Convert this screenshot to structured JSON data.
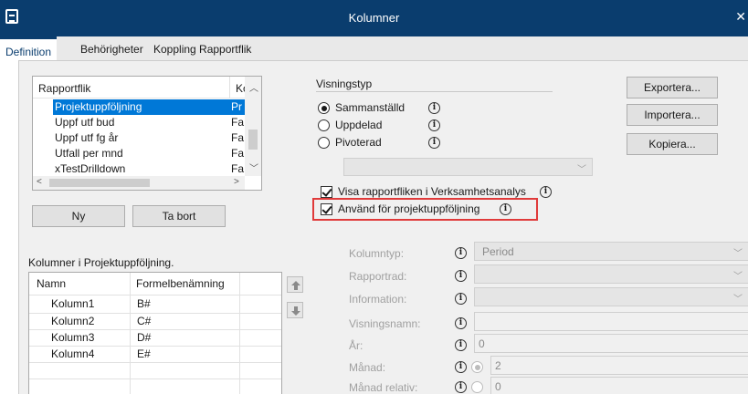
{
  "window": {
    "title": "Kolumner"
  },
  "tabs": [
    "Definition",
    "Behörigheter",
    "Koppling Rapportflik"
  ],
  "rapportflik": {
    "header_name": "Rapportflik",
    "header_ko": "Ko",
    "rows": [
      {
        "name": "Projektuppföljning",
        "ko": "Pr",
        "selected": true
      },
      {
        "name": "Uppf utf bud",
        "ko": "Fa"
      },
      {
        "name": "Uppf utf fg år",
        "ko": "Fa"
      },
      {
        "name": "Utfall per mnd",
        "ko": "Fa"
      },
      {
        "name": "xTestDrilldown",
        "ko": "Fa"
      }
    ]
  },
  "buttons": {
    "ny": "Ny",
    "ta_bort": "Ta bort",
    "exportera": "Exportera...",
    "importera": "Importera...",
    "kopiera": "Kopiera..."
  },
  "kolumner": {
    "group_label": "Kolumner i Projektuppföljning.",
    "col_name": "Namn",
    "col_formel": "Formelbenämning",
    "rows": [
      {
        "name": "Kolumn1",
        "formel": "B#"
      },
      {
        "name": "Kolumn2",
        "formel": "C#"
      },
      {
        "name": "Kolumn3",
        "formel": "D#"
      },
      {
        "name": "Kolumn4",
        "formel": "E#"
      }
    ]
  },
  "visningstyp": {
    "label": "Visningstyp",
    "options": [
      {
        "label": "Sammanställd",
        "checked": true
      },
      {
        "label": "Uppdelad",
        "checked": false
      },
      {
        "label": "Pivoterad",
        "checked": false
      }
    ]
  },
  "checkboxes": {
    "visa": {
      "label": "Visa rapportfliken i Verksamhetsanalys",
      "checked": true
    },
    "anvand": {
      "label": "Använd för projektuppföljning",
      "checked": true
    }
  },
  "fields": {
    "kolumntyp": {
      "label": "Kolumntyp:",
      "value": "Period"
    },
    "rapportrad": {
      "label": "Rapportrad:",
      "value": ""
    },
    "information": {
      "label": "Information:",
      "value": ""
    },
    "visningsnamn": {
      "label": "Visningsnamn:",
      "value": ""
    },
    "ar": {
      "label": "År:",
      "value": "0"
    },
    "manad": {
      "label": "Månad:",
      "value": "2"
    },
    "manad_relativ": {
      "label": "Månad relativ:",
      "value": "0"
    }
  },
  "icons": {
    "info": "info-icon",
    "up": "arrow-up-icon",
    "down": "arrow-down-icon",
    "close": "close-icon",
    "app": "app-icon"
  },
  "colors": {
    "titlebar": "#0a3d6e",
    "selection": "#0078d7",
    "highlight": "#e03a3a"
  }
}
